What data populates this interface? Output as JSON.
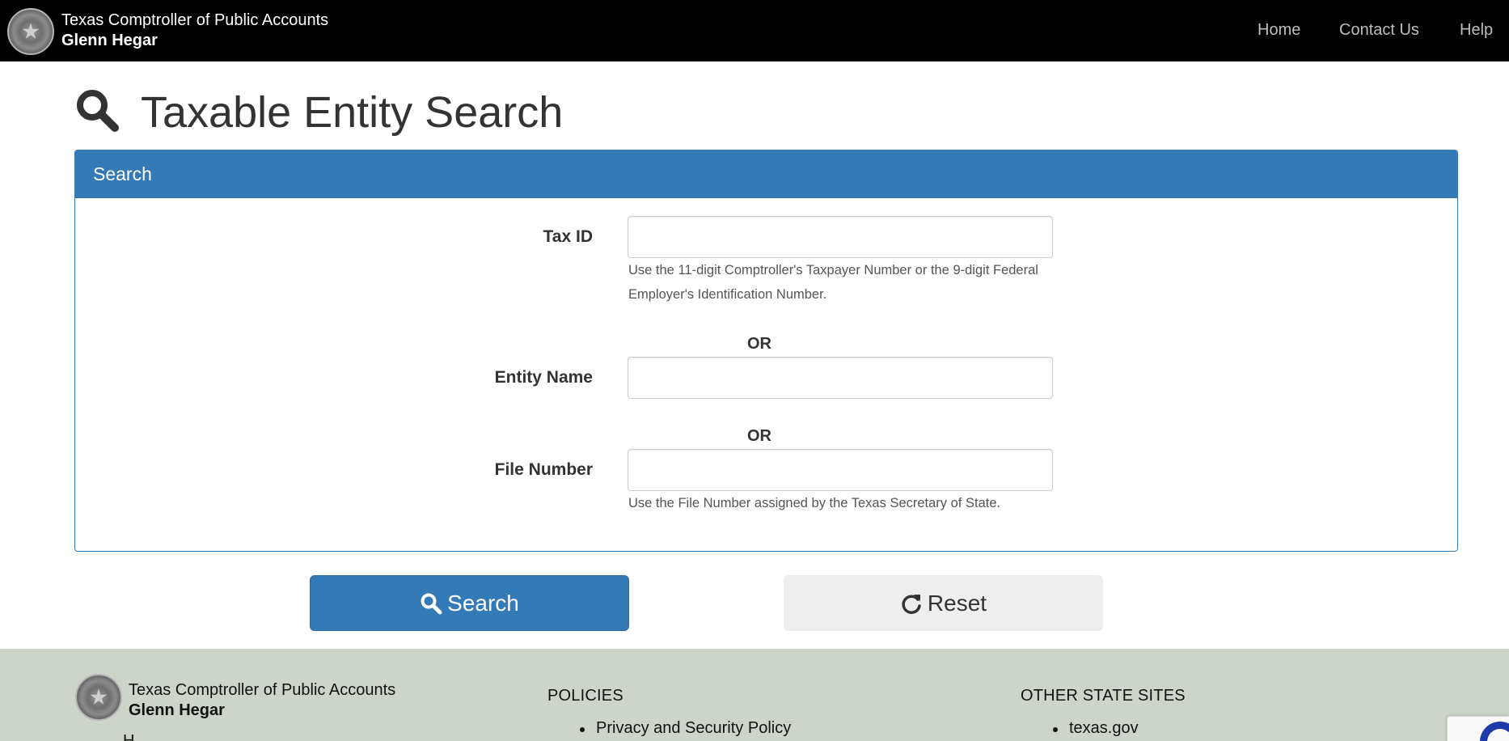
{
  "header": {
    "org_name": "Texas Comptroller of Public Accounts",
    "official_name": "Glenn Hegar",
    "seal_icon": "texas-state-seal-icon",
    "nav": [
      {
        "label": "Home"
      },
      {
        "label": "Contact Us"
      },
      {
        "label": "Help"
      }
    ]
  },
  "page": {
    "title": "Taxable Entity Search",
    "title_icon": "search-icon"
  },
  "search_panel": {
    "heading": "Search",
    "tax_id": {
      "label": "Tax ID",
      "value": "",
      "help": "Use the 11-digit Comptroller's Taxpayer Number or the 9-digit Federal Employer's Identification Number."
    },
    "or_1": "OR",
    "entity_name": {
      "label": "Entity Name",
      "value": ""
    },
    "or_2": "OR",
    "file_number": {
      "label": "File Number",
      "value": "",
      "help": "Use the File Number assigned by the Texas Secretary of State."
    }
  },
  "actions": {
    "search_label": "Search",
    "search_icon": "search-icon",
    "reset_label": "Reset",
    "reset_icon": "refresh-icon"
  },
  "footer": {
    "org_name": "Texas Comptroller of Public Accounts",
    "official_name": "Glenn Hegar",
    "partial_link": "H",
    "policies_heading": "POLICIES",
    "policies_items": [
      "Privacy and Security Policy"
    ],
    "other_sites_heading": "OTHER STATE SITES",
    "other_sites_items": [
      "texas.gov"
    ]
  },
  "colors": {
    "header_bg": "#000000",
    "primary": "#337ab7",
    "footer_bg": "#cdd5cb",
    "reset_bg": "#eeeeee"
  }
}
